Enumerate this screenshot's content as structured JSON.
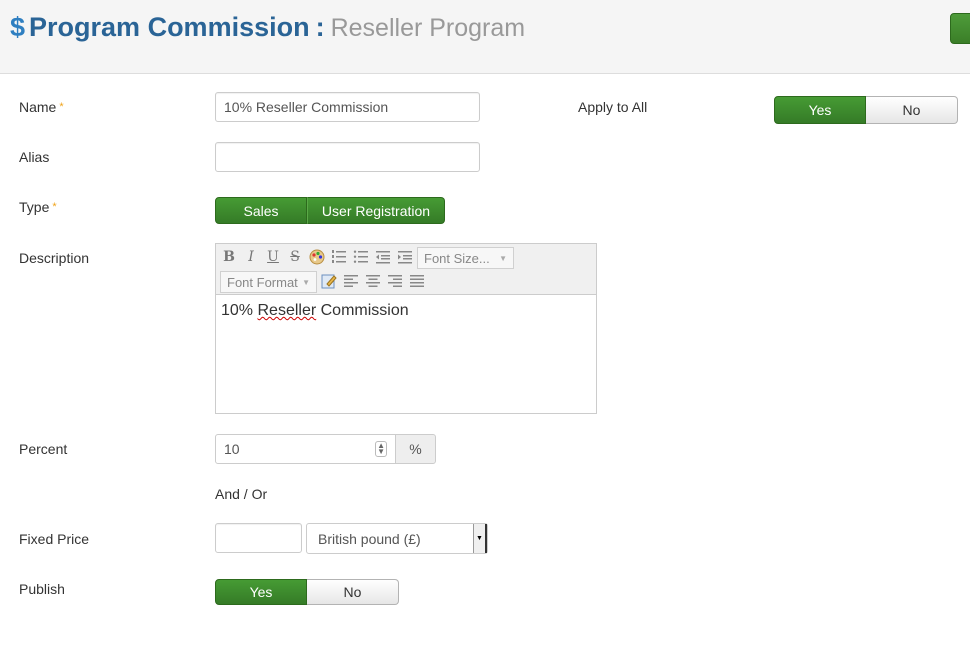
{
  "header": {
    "icon": "dollar-icon",
    "title": "Program Commission",
    "separator": ":",
    "subtitle": "Reseller Program",
    "accent_color": "#2a6496"
  },
  "form": {
    "name": {
      "label": "Name",
      "required_mark": "*",
      "value": "10% Reseller Commission"
    },
    "alias": {
      "label": "Alias",
      "value": ""
    },
    "apply_to_all": {
      "label": "Apply to All",
      "options": [
        "Yes",
        "No"
      ],
      "selected": "Yes"
    },
    "type": {
      "label": "Type",
      "required_mark": "*",
      "options": [
        "Sales",
        "User Registration"
      ]
    },
    "description": {
      "label": "Description",
      "toolbar": {
        "font_size_placeholder": "Font Size...",
        "font_format_placeholder": "Font Format"
      },
      "content_prefix": "10%",
      "content_misspelled": "Reseller",
      "content_suffix": "Commission"
    },
    "percent": {
      "label": "Percent",
      "value": "10",
      "unit": "%"
    },
    "and_or": "And / Or",
    "fixed_price": {
      "label": "Fixed Price",
      "value": "",
      "currency": "British pound (£)"
    },
    "publish": {
      "label": "Publish",
      "options": [
        "Yes",
        "No"
      ],
      "selected": "Yes"
    }
  },
  "colors": {
    "active_green": "#3d8b2e",
    "required": "#f0a31a"
  }
}
